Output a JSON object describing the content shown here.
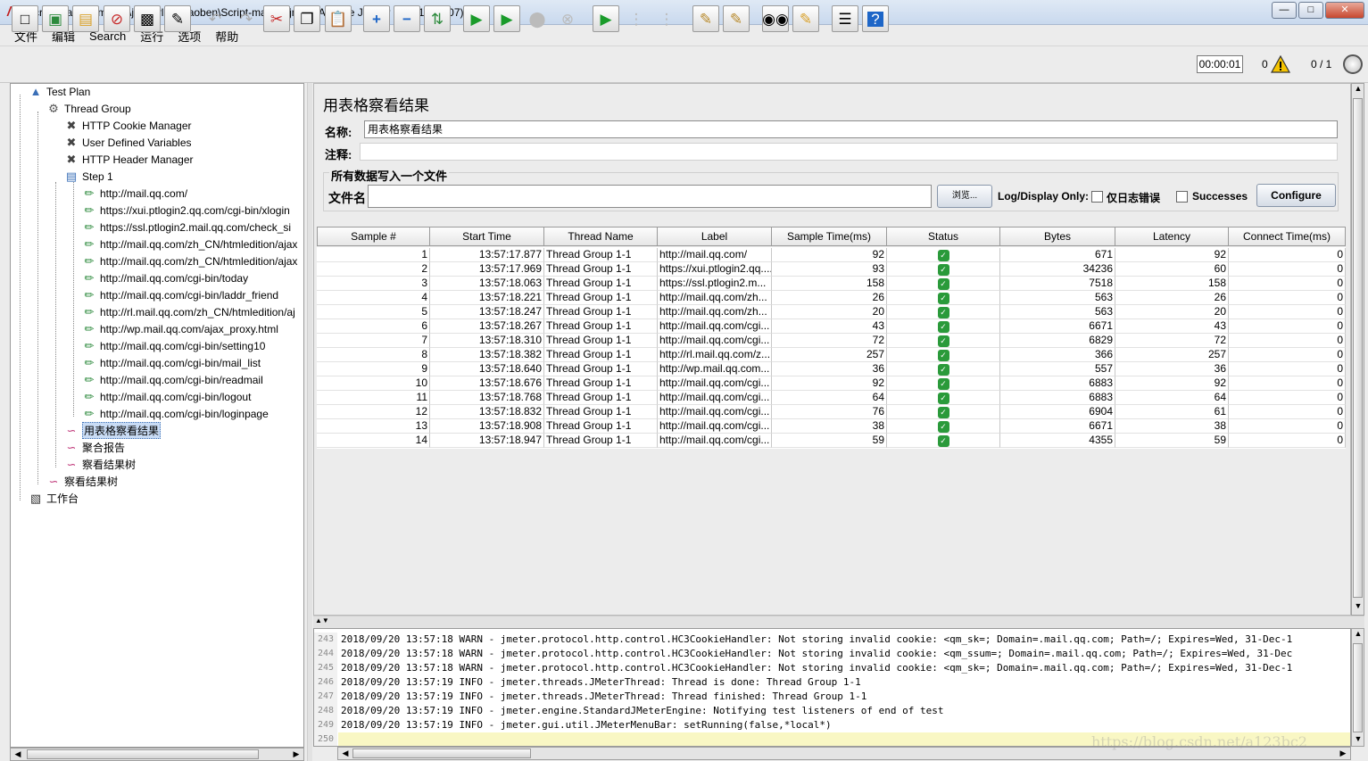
{
  "window": {
    "title": "Script-mail.qq.jmx (E:\\jmeterluzhijiaoben\\Script-mail.qq.jmx) - Apache JMeter (3.0 r1743807)"
  },
  "menu": [
    "文件",
    "编辑",
    "Search",
    "运行",
    "选项",
    "帮助"
  ],
  "toolbar": {
    "icons": [
      "new-icon",
      "templates-icon",
      "open-icon",
      "close-icon",
      "save-icon",
      "save-as-icon",
      "undo-icon",
      "redo-icon",
      "cut-icon",
      "copy-icon",
      "paste-icon",
      "expand-icon",
      "collapse-icon",
      "toggle-icon",
      "start-icon",
      "start-no-pause-icon",
      "stop-icon",
      "shutdown-icon",
      "remote-start-icon",
      "remote-stop-icon",
      "remote-exit-icon",
      "clear-icon",
      "clear-all-icon",
      "search-icon",
      "reset-search-icon",
      "function-helper-icon",
      "help-icon"
    ],
    "elapsed": "00:00:01",
    "warn_count": "0",
    "threads": "0 / 1"
  },
  "tree": {
    "nodes": [
      {
        "label": "Test Plan",
        "icon": "test-plan-icon"
      },
      {
        "label": "Thread Group",
        "icon": "thread-group-icon"
      },
      {
        "label": "HTTP Cookie Manager",
        "icon": "config-icon"
      },
      {
        "label": "User Defined Variables",
        "icon": "config-icon"
      },
      {
        "label": "HTTP Header Manager",
        "icon": "config-icon"
      },
      {
        "label": "Step 1",
        "icon": "controller-icon"
      },
      {
        "label": "http://mail.qq.com/",
        "icon": "sampler-icon"
      },
      {
        "label": "https://xui.ptlogin2.qq.com/cgi-bin/xlogin",
        "icon": "sampler-icon"
      },
      {
        "label": "https://ssl.ptlogin2.mail.qq.com/check_si",
        "icon": "sampler-icon"
      },
      {
        "label": "http://mail.qq.com/zh_CN/htmledition/ajax",
        "icon": "sampler-icon"
      },
      {
        "label": "http://mail.qq.com/zh_CN/htmledition/ajax",
        "icon": "sampler-icon"
      },
      {
        "label": "http://mail.qq.com/cgi-bin/today",
        "icon": "sampler-icon"
      },
      {
        "label": "http://mail.qq.com/cgi-bin/laddr_friend",
        "icon": "sampler-icon"
      },
      {
        "label": "http://rl.mail.qq.com/zh_CN/htmledition/aj",
        "icon": "sampler-icon"
      },
      {
        "label": "http://wp.mail.qq.com/ajax_proxy.html",
        "icon": "sampler-icon"
      },
      {
        "label": "http://mail.qq.com/cgi-bin/setting10",
        "icon": "sampler-icon"
      },
      {
        "label": "http://mail.qq.com/cgi-bin/mail_list",
        "icon": "sampler-icon"
      },
      {
        "label": "http://mail.qq.com/cgi-bin/readmail",
        "icon": "sampler-icon"
      },
      {
        "label": "http://mail.qq.com/cgi-bin/logout",
        "icon": "sampler-icon"
      },
      {
        "label": "http://mail.qq.com/cgi-bin/loginpage",
        "icon": "sampler-icon"
      },
      {
        "label": "用表格察看结果",
        "icon": "listener-icon"
      },
      {
        "label": "聚合报告",
        "icon": "listener-icon"
      },
      {
        "label": "察看结果树",
        "icon": "listener-icon"
      },
      {
        "label": "察看结果树",
        "icon": "listener-icon"
      },
      {
        "label": "工作台",
        "icon": "workbench-icon"
      }
    ]
  },
  "panel": {
    "title": "用表格察看结果",
    "name_label": "名称:",
    "name_value": "用表格察看结果",
    "comment_label": "注释:",
    "comment_value": "",
    "file_group_label": "所有数据写入一个文件",
    "filename_label": "文件名",
    "filename_value": "",
    "browse_button": "浏览...",
    "log_display_label": "Log/Display Only:",
    "errors_only_label": "仅日志错误",
    "successes_label": "Successes",
    "configure_button": "Configure"
  },
  "table": {
    "columns": [
      "Sample #",
      "Start Time",
      "Thread Name",
      "Label",
      "Sample Time(ms)",
      "Status",
      "Bytes",
      "Latency",
      "Connect Time(ms)"
    ],
    "rows": [
      [
        "1",
        "13:57:17.877",
        "Thread Group 1-1",
        "http://mail.qq.com/",
        "92",
        "ok",
        "671",
        "92",
        "0"
      ],
      [
        "2",
        "13:57:17.969",
        "Thread Group 1-1",
        "https://xui.ptlogin2.qq....",
        "93",
        "ok",
        "34236",
        "60",
        "0"
      ],
      [
        "3",
        "13:57:18.063",
        "Thread Group 1-1",
        "https://ssl.ptlogin2.m...",
        "158",
        "ok",
        "7518",
        "158",
        "0"
      ],
      [
        "4",
        "13:57:18.221",
        "Thread Group 1-1",
        "http://mail.qq.com/zh...",
        "26",
        "ok",
        "563",
        "26",
        "0"
      ],
      [
        "5",
        "13:57:18.247",
        "Thread Group 1-1",
        "http://mail.qq.com/zh...",
        "20",
        "ok",
        "563",
        "20",
        "0"
      ],
      [
        "6",
        "13:57:18.267",
        "Thread Group 1-1",
        "http://mail.qq.com/cgi...",
        "43",
        "ok",
        "6671",
        "43",
        "0"
      ],
      [
        "7",
        "13:57:18.310",
        "Thread Group 1-1",
        "http://mail.qq.com/cgi...",
        "72",
        "ok",
        "6829",
        "72",
        "0"
      ],
      [
        "8",
        "13:57:18.382",
        "Thread Group 1-1",
        "http://rl.mail.qq.com/z...",
        "257",
        "ok",
        "366",
        "257",
        "0"
      ],
      [
        "9",
        "13:57:18.640",
        "Thread Group 1-1",
        "http://wp.mail.qq.com...",
        "36",
        "ok",
        "557",
        "36",
        "0"
      ],
      [
        "10",
        "13:57:18.676",
        "Thread Group 1-1",
        "http://mail.qq.com/cgi...",
        "92",
        "ok",
        "6883",
        "92",
        "0"
      ],
      [
        "11",
        "13:57:18.768",
        "Thread Group 1-1",
        "http://mail.qq.com/cgi...",
        "64",
        "ok",
        "6883",
        "64",
        "0"
      ],
      [
        "12",
        "13:57:18.832",
        "Thread Group 1-1",
        "http://mail.qq.com/cgi...",
        "76",
        "ok",
        "6904",
        "61",
        "0"
      ],
      [
        "13",
        "13:57:18.908",
        "Thread Group 1-1",
        "http://mail.qq.com/cgi...",
        "38",
        "ok",
        "6671",
        "38",
        "0"
      ],
      [
        "14",
        "13:57:18.947",
        "Thread Group 1-1",
        "http://mail.qq.com/cgi...",
        "59",
        "ok",
        "4355",
        "59",
        "0"
      ]
    ]
  },
  "log": {
    "lines": [
      {
        "num": "243",
        "text": "2018/09/20 13:57:18 WARN  - jmeter.protocol.http.control.HC3CookieHandler: Not storing invalid cookie: <qm_sk=; Domain=.mail.qq.com; Path=/; Expires=Wed, 31-Dec-1"
      },
      {
        "num": "244",
        "text": "2018/09/20 13:57:18 WARN  - jmeter.protocol.http.control.HC3CookieHandler: Not storing invalid cookie: <qm_ssum=; Domain=.mail.qq.com; Path=/; Expires=Wed, 31-Dec"
      },
      {
        "num": "245",
        "text": "2018/09/20 13:57:18 WARN  - jmeter.protocol.http.control.HC3CookieHandler: Not storing invalid cookie: <qm_sk=; Domain=.mail.qq.com; Path=/; Expires=Wed, 31-Dec-1"
      },
      {
        "num": "246",
        "text": "2018/09/20 13:57:19 INFO  - jmeter.threads.JMeterThread: Thread is done: Thread Group 1-1"
      },
      {
        "num": "247",
        "text": "2018/09/20 13:57:19 INFO  - jmeter.threads.JMeterThread: Thread finished: Thread Group 1-1"
      },
      {
        "num": "248",
        "text": "2018/09/20 13:57:19 INFO  - jmeter.engine.StandardJMeterEngine: Notifying test listeners of end of test"
      },
      {
        "num": "249",
        "text": "2018/09/20 13:57:19 INFO  - jmeter.gui.util.JMeterMenuBar: setRunning(false,*local*)"
      },
      {
        "num": "250",
        "text": ""
      }
    ],
    "watermark": "https://blog.csdn.net/a123bc2"
  }
}
